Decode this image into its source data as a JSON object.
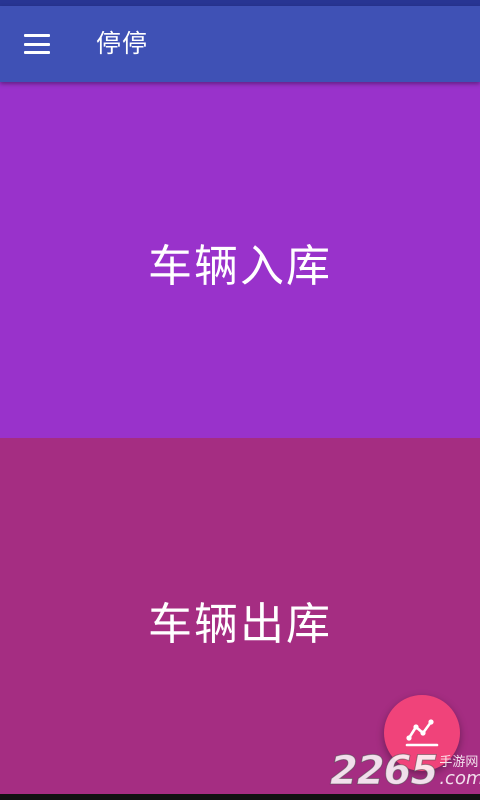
{
  "app_bar": {
    "title": "停停",
    "menu_icon": "hamburger-menu-icon",
    "color": "#3f51b5"
  },
  "actions": {
    "entry_label": "车辆入库",
    "exit_label": "车辆出库",
    "entry_color": "#9932cb",
    "exit_color": "#a52d82"
  },
  "fab": {
    "icon": "line-chart-icon",
    "color": "#f0437a"
  },
  "watermark": {
    "digits": "2265",
    "cn": "手游网",
    "com": ".com"
  }
}
